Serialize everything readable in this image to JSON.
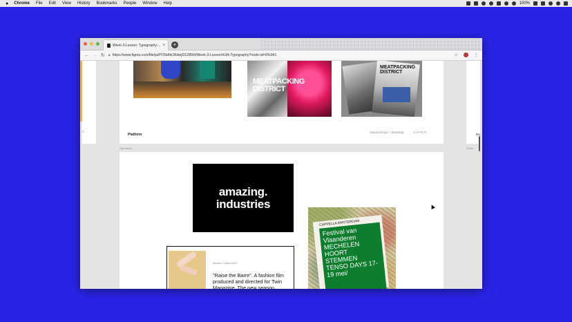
{
  "menubar": {
    "apple": "",
    "items": [
      "Chrome",
      "File",
      "Edit",
      "View",
      "History",
      "Bookmarks",
      "People",
      "Window",
      "Help"
    ],
    "battery": "100%"
  },
  "browser": {
    "tab_title": "Week-3-Lesson: Typography-...",
    "tab_close": "×",
    "new_tab": "+",
    "url": "https://www.figma.com/file/psPl76b8rk36dwjD1Z8l94/Week-3-Lesson%3A-Typography?node-id=0%3A1"
  },
  "canvas": {
    "platform_label": "Platform",
    "visual_design_label": "Visual Design + Branding",
    "super_label": "SUPER",
    "right_edge_label": "Mo",
    "left_edge_label": "A",
    "operators_label": "Operators",
    "script_label": "Script",
    "meatpacking_text": "MEATPACKING DISTRICT",
    "amazing_line1": "amazing.",
    "amazing_line2": "industries",
    "poster_small": "CAPPELLA AMSTERDAM",
    "poster_title": "Festival van Vlaanderen MECHELEN HOORT STEMMEN TENSO DAYS 17-19 mei/",
    "card_kicker": "PROJECT | CASE STUDY",
    "card_headline": "\"Raise the Barre\". A fashion film produced and directed for Twin Magazine. The new season"
  },
  "colors": {
    "desktop": "#2a23e6",
    "poster_green": "#0f7d2e"
  }
}
